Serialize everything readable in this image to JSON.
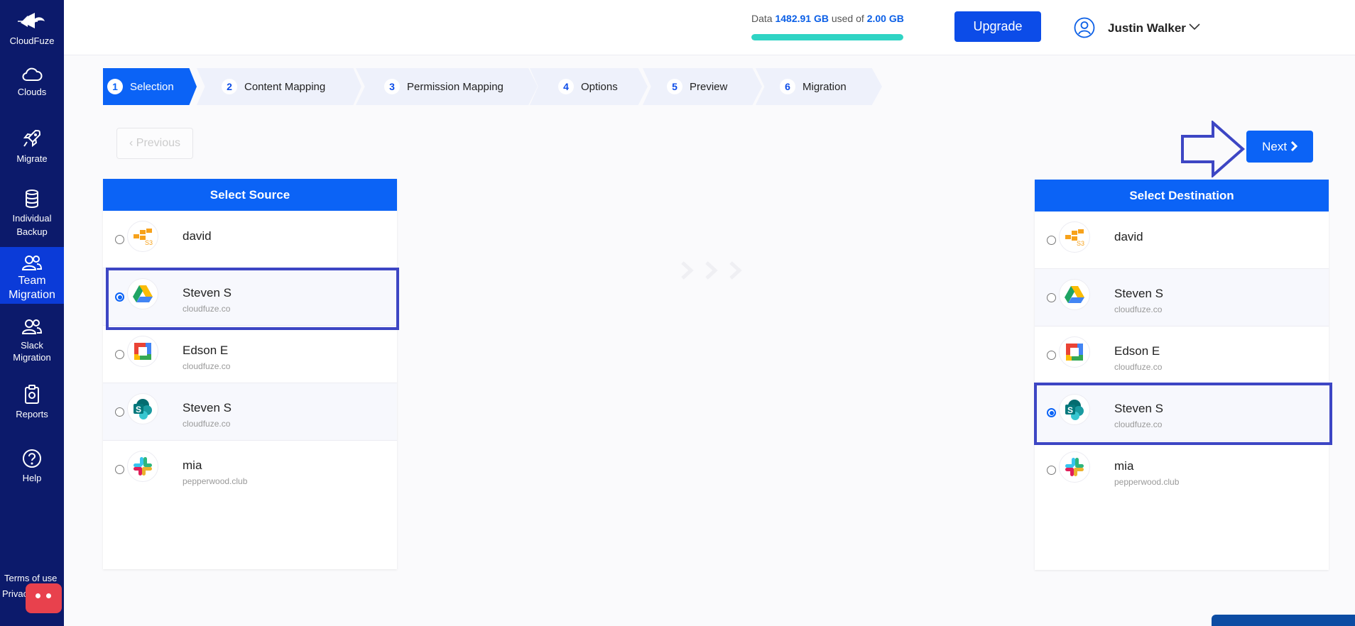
{
  "sidebar": {
    "logo_label": "CloudFuze",
    "items": [
      {
        "label": "Clouds",
        "icon": "cloud-icon"
      },
      {
        "label": "Migrate",
        "icon": "rocket-icon"
      },
      {
        "label": "Individual Backup",
        "icon": "database-icon"
      },
      {
        "label": "Team Migration",
        "icon": "team-icon"
      },
      {
        "label": "Slack Migration",
        "icon": "team-icon"
      },
      {
        "label": "Reports",
        "icon": "clipboard-icon"
      },
      {
        "label": "Help",
        "icon": "help-icon"
      }
    ],
    "footer_terms": "Terms of use",
    "footer_privacy": "Privac"
  },
  "header": {
    "storage_prefix": "Data",
    "storage_used": "1482.91 GB",
    "storage_mid": "used of",
    "storage_total": "2.00 GB",
    "storage_fill_percent": 100,
    "upgrade_label": "Upgrade",
    "user_name": "Justin Walker"
  },
  "steps": [
    {
      "num": "1",
      "label": "Selection",
      "active": true
    },
    {
      "num": "2",
      "label": "Content Mapping",
      "active": false
    },
    {
      "num": "3",
      "label": "Permission Mapping",
      "active": false
    },
    {
      "num": "4",
      "label": "Options",
      "active": false
    },
    {
      "num": "5",
      "label": "Preview",
      "active": false
    },
    {
      "num": "6",
      "label": "Migration",
      "active": false
    }
  ],
  "nav": {
    "previous_label": "Previous",
    "next_label": "Next"
  },
  "source": {
    "title": "Select Source",
    "items": [
      {
        "name": "david",
        "domain": "",
        "icon": "amazon-s3-icon",
        "selected": false
      },
      {
        "name": "Steven S",
        "domain": "cloudfuze.co",
        "icon": "google-drive-icon",
        "selected": true
      },
      {
        "name": "Edson E",
        "domain": "cloudfuze.co",
        "icon": "google-workspace-icon",
        "selected": false
      },
      {
        "name": "Steven S",
        "domain": "cloudfuze.co",
        "icon": "sharepoint-icon",
        "selected": false
      },
      {
        "name": "mia",
        "domain": "pepperwood.club",
        "icon": "slack-icon",
        "selected": false
      }
    ]
  },
  "destination": {
    "title": "Select Destination",
    "items": [
      {
        "name": "david",
        "domain": "",
        "icon": "amazon-s3-icon",
        "selected": false
      },
      {
        "name": "Steven S",
        "domain": "cloudfuze.co",
        "icon": "google-drive-icon",
        "selected": false
      },
      {
        "name": "Edson E",
        "domain": "cloudfuze.co",
        "icon": "google-workspace-icon",
        "selected": false
      },
      {
        "name": "Steven S",
        "domain": "cloudfuze.co",
        "icon": "sharepoint-icon",
        "selected": true
      },
      {
        "name": "mia",
        "domain": "pepperwood.club",
        "icon": "slack-icon",
        "selected": false
      }
    ]
  },
  "colors": {
    "sidebar": "#0c1a6b",
    "accent": "#0b63f6",
    "highlight": "#3d46c4"
  }
}
